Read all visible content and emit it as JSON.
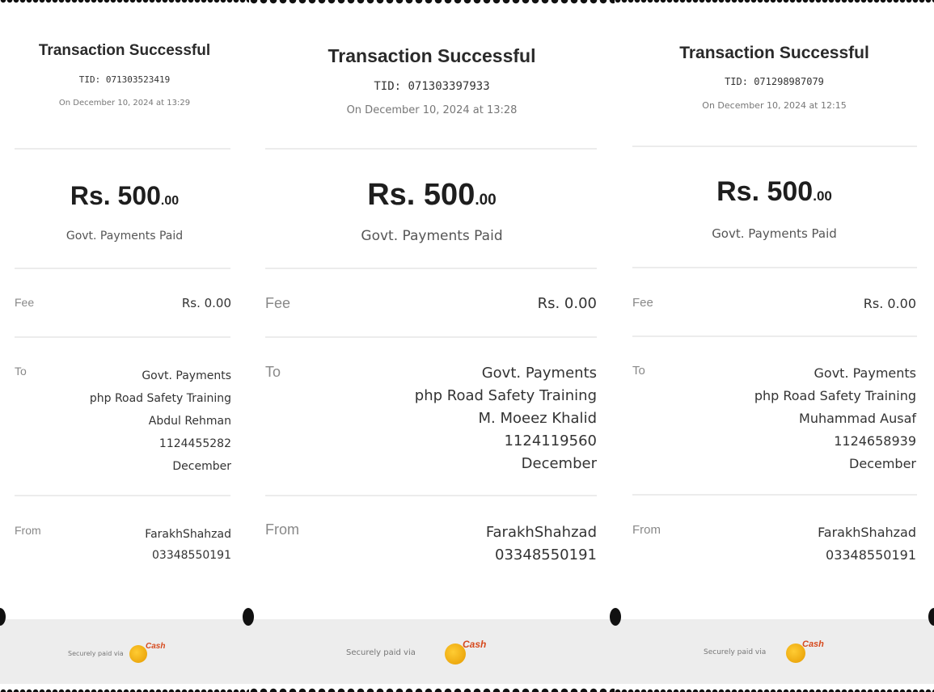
{
  "receipts": [
    {
      "title": "Transaction Successful",
      "tid": "TID: 071303523419",
      "date": "On December 10, 2024 at 13:29",
      "amount_main": "Rs. 500",
      "amount_decimal": ".00",
      "amount_label": "Govt. Payments Paid",
      "fee_label": "Fee",
      "fee_value": "Rs. 0.00",
      "to_label": "To",
      "to_lines": [
        "Govt. Payments",
        "php Road Safety Training",
        "Abdul Rehman",
        "1124455282",
        "December"
      ],
      "from_label": "From",
      "from_lines": [
        "FarakhShahzad",
        "03348550191"
      ],
      "footer_text": "Securely paid via",
      "logo_text": "Cash"
    },
    {
      "title": "Transaction Successful",
      "tid": "TID: 071303397933",
      "date": "On December 10, 2024 at 13:28",
      "amount_main": "Rs. 500",
      "amount_decimal": ".00",
      "amount_label": "Govt. Payments Paid",
      "fee_label": "Fee",
      "fee_value": "Rs. 0.00",
      "to_label": "To",
      "to_lines": [
        "Govt. Payments",
        "php Road Safety Training",
        "M. Moeez Khalid",
        "1124119560",
        "December"
      ],
      "from_label": "From",
      "from_lines": [
        "FarakhShahzad",
        "03348550191"
      ],
      "footer_text": "Securely paid via",
      "logo_text": "Cash"
    },
    {
      "title": "Transaction Successful",
      "tid": "TID: 071298987079",
      "date": "On December 10, 2024 at 12:15",
      "amount_main": "Rs. 500",
      "amount_decimal": ".00",
      "amount_label": "Govt. Payments Paid",
      "fee_label": "Fee",
      "fee_value": "Rs. 0.00",
      "to_label": "To",
      "to_lines": [
        "Govt. Payments",
        "php Road Safety Training",
        "Muhammad Ausaf",
        "1124658939",
        "December"
      ],
      "from_label": "From",
      "from_lines": [
        "FarakhShahzad",
        "03348550191"
      ],
      "footer_text": "Securely paid via",
      "logo_text": "Cash"
    }
  ],
  "colors": {
    "footer_bg": "#ededed",
    "logo_orange": "#e59a00",
    "logo_red": "#d64a1e",
    "divider": "#ececec"
  }
}
